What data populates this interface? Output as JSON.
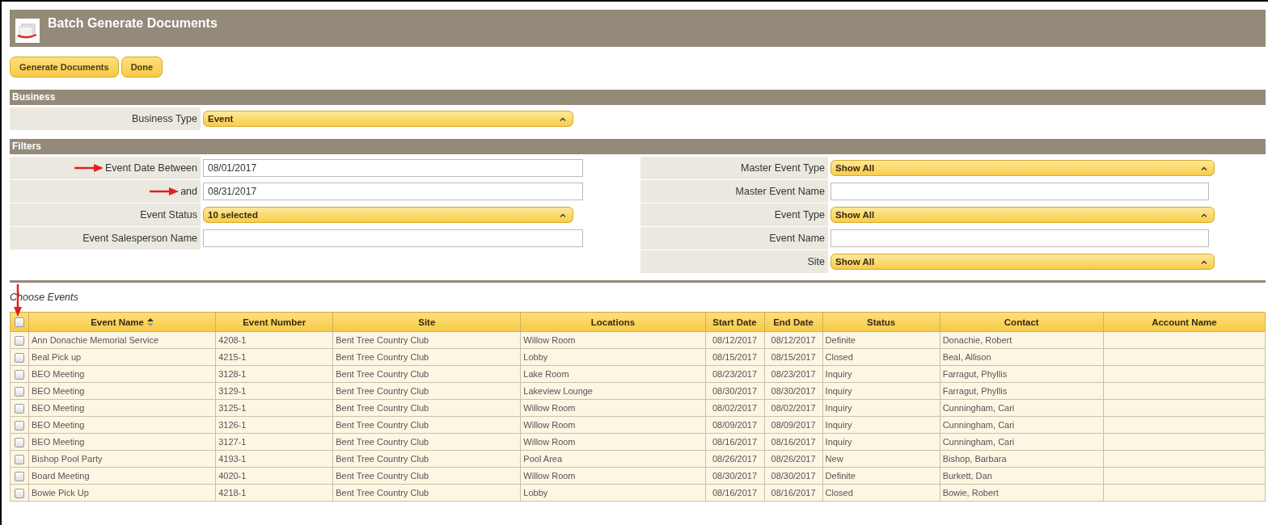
{
  "window": {
    "title": "Batch Generate Documents"
  },
  "toolbar": {
    "buttons": [
      "Generate Documents",
      "Done"
    ]
  },
  "business": {
    "heading": "Business",
    "fields": [
      {
        "label": "Business Type",
        "kind": "select",
        "value": "Event",
        "marked": false
      }
    ]
  },
  "filters": {
    "heading": "Filters",
    "left": [
      {
        "label": "Event Date Between",
        "kind": "text",
        "value": "08/01/2017",
        "marked": true
      },
      {
        "label": "and",
        "kind": "text",
        "value": "08/31/2017",
        "marked": true
      },
      {
        "label": "Event Status",
        "kind": "select",
        "value": "10 selected",
        "marked": false
      },
      {
        "label": "Event Salesperson Name",
        "kind": "text",
        "marked": false
      }
    ],
    "right": [
      {
        "label": "Master Event Type",
        "kind": "select",
        "value": "Show All",
        "marked": false
      },
      {
        "label": "Master Event Name",
        "kind": "text",
        "marked": false
      },
      {
        "label": "Event Type",
        "kind": "select",
        "value": "Show All",
        "marked": false
      },
      {
        "label": "Event Name",
        "kind": "text",
        "marked": false
      },
      {
        "label": "Site",
        "kind": "select",
        "value": "Show All",
        "marked": false
      }
    ]
  },
  "events": {
    "caption": "Choose Events",
    "select_all": {
      "checked": false,
      "marked": true
    },
    "columns": [
      {
        "label": "Event Name",
        "sorted": true
      },
      {
        "label": "Event Number",
        "sorted": false
      },
      {
        "label": "Site",
        "sorted": false
      },
      {
        "label": "Locations",
        "sorted": false
      },
      {
        "label": "Start Date",
        "sorted": false
      },
      {
        "label": "End Date",
        "sorted": false
      },
      {
        "label": "Status",
        "sorted": false
      },
      {
        "label": "Contact",
        "sorted": false
      },
      {
        "label": "Account Name",
        "sorted": false
      }
    ],
    "rows": [
      {
        "checked": false,
        "cells": [
          "Ann Donachie Memorial Service",
          "4208-1",
          "Bent Tree Country Club",
          "Willow Room",
          "08/12/2017",
          "08/12/2017",
          "Definite",
          "Donachie, Robert",
          ""
        ]
      },
      {
        "checked": false,
        "cells": [
          "Beal Pick up",
          "4215-1",
          "Bent Tree Country Club",
          "Lobby",
          "08/15/2017",
          "08/15/2017",
          "Closed",
          "Beal, Allison",
          ""
        ]
      },
      {
        "checked": false,
        "cells": [
          "BEO Meeting",
          "3128-1",
          "Bent Tree Country Club",
          "Lake Room",
          "08/23/2017",
          "08/23/2017",
          "Inquiry",
          "Farragut, Phyllis",
          ""
        ]
      },
      {
        "checked": false,
        "cells": [
          "BEO Meeting",
          "3129-1",
          "Bent Tree Country Club",
          "Lakeview Lounge",
          "08/30/2017",
          "08/30/2017",
          "Inquiry",
          "Farragut, Phyllis",
          ""
        ]
      },
      {
        "checked": false,
        "cells": [
          "BEO Meeting",
          "3125-1",
          "Bent Tree Country Club",
          "Willow Room",
          "08/02/2017",
          "08/02/2017",
          "Inquiry",
          "Cunningham, Cari",
          ""
        ]
      },
      {
        "checked": false,
        "cells": [
          "BEO Meeting",
          "3126-1",
          "Bent Tree Country Club",
          "Willow Room",
          "08/09/2017",
          "08/09/2017",
          "Inquiry",
          "Cunningham, Cari",
          ""
        ]
      },
      {
        "checked": false,
        "cells": [
          "BEO Meeting",
          "3127-1",
          "Bent Tree Country Club",
          "Willow Room",
          "08/16/2017",
          "08/16/2017",
          "Inquiry",
          "Cunningham, Cari",
          ""
        ]
      },
      {
        "checked": false,
        "cells": [
          "Bishop Pool Party",
          "4193-1",
          "Bent Tree Country Club",
          "Pool Area",
          "08/26/2017",
          "08/26/2017",
          "New",
          "Bishop, Barbara",
          ""
        ]
      },
      {
        "checked": false,
        "cells": [
          "Board Meeting",
          "4020-1",
          "Bent Tree Country Club",
          "Willow Room",
          "08/30/2017",
          "08/30/2017",
          "Definite",
          "Burkett, Dan",
          ""
        ]
      },
      {
        "checked": false,
        "cells": [
          "Bowie Pick Up",
          "4218-1",
          "Bent Tree Country Club",
          "Lobby",
          "08/16/2017",
          "08/16/2017",
          "Closed",
          "Bowie, Robert",
          ""
        ]
      }
    ]
  }
}
